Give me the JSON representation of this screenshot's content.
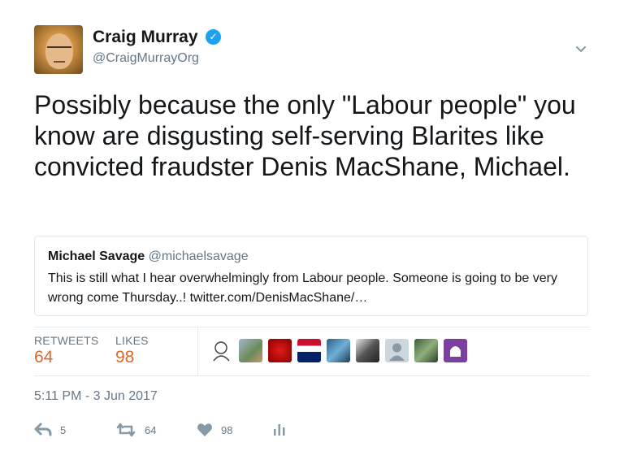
{
  "author": {
    "name": "Craig Murray",
    "handle": "@CraigMurrayOrg"
  },
  "tweet": {
    "text": "Possibly because the only \"Labour people\" you know are disgusting self-serving Blarites like convicted fraudster Denis MacShane, Michael."
  },
  "quoted": {
    "name": "Michael Savage",
    "handle": "@michaelsavage",
    "text": "This is still what I hear overwhelmingly from Labour people. Someone is going to be very wrong come Thursday..! twitter.com/DenisMacShane/…"
  },
  "stats": {
    "retweets_label": "RETWEETS",
    "retweets": "64",
    "likes_label": "LIKES",
    "likes": "98"
  },
  "likers_icons": [
    "cartoon-avatar",
    "person-avatar",
    "red-avatar",
    "flag-avatar",
    "blue-avatar",
    "person-avatar",
    "default-avatar",
    "green-avatar",
    "purple-avatar"
  ],
  "timestamp": "5:11 PM - 3 Jun 2017",
  "actions": {
    "reply_count": "5",
    "retweet_count": "64",
    "like_count": "98"
  },
  "colors": {
    "text": "#14171a",
    "secondary": "#657786",
    "verified": "#1da1f2",
    "stat_value": "#e0672a",
    "border": "#e1e8ed"
  }
}
